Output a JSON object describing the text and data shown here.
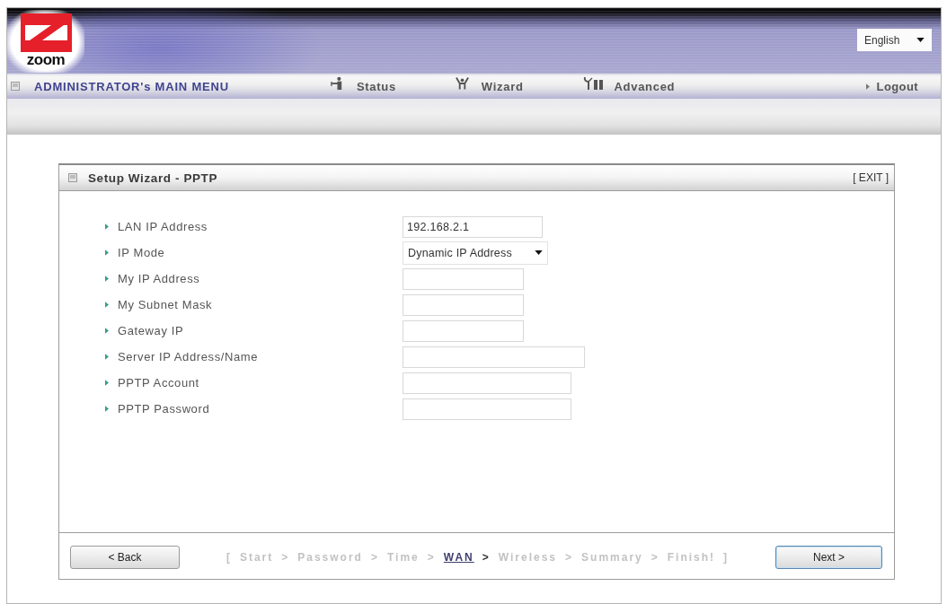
{
  "header": {
    "logo": {
      "text": "zoom"
    },
    "language": {
      "value": "English"
    }
  },
  "menu": {
    "title": "ADMINISTRATOR's MAIN MENU",
    "items": [
      {
        "label": "Status",
        "kind": "status"
      },
      {
        "label": "Wizard",
        "kind": "wizard"
      },
      {
        "label": "Advanced",
        "kind": "advanced"
      }
    ],
    "logout": "Logout"
  },
  "panel": {
    "title": "Setup Wizard - PPTP",
    "exit": "[ EXIT ]",
    "fields": [
      {
        "label": "LAN IP Address",
        "kind": "text",
        "value": "192.168.2.1"
      },
      {
        "label": "IP Mode",
        "kind": "select",
        "value": "Dynamic IP Address"
      },
      {
        "label": "My IP Address",
        "kind": "text"
      },
      {
        "label": "My Subnet Mask",
        "kind": "text"
      },
      {
        "label": "Gateway IP",
        "kind": "text"
      },
      {
        "label": "Server IP Address/Name",
        "kind": "text"
      },
      {
        "label": "PPTP Account",
        "kind": "text"
      },
      {
        "label": "PPTP Password",
        "kind": "password"
      }
    ]
  },
  "footer": {
    "back_button": "< Back",
    "progress": {
      "open": "[",
      "close": "]",
      "steps": [
        {
          "label": "Start",
          "separator": ">",
          "selected": false
        },
        {
          "label": "Password",
          "separator": ">",
          "selected": false
        },
        {
          "label": "Time",
          "separator": ">",
          "selected": false
        },
        {
          "label": "WAN",
          "separator": ">",
          "selected": true
        },
        {
          "label": "Wireless",
          "separator": ">",
          "selected": false
        },
        {
          "label": "Summary",
          "separator": ">",
          "selected": false
        },
        {
          "label": "Finish!",
          "selected": false
        }
      ]
    },
    "next_button": "Next >"
  }
}
